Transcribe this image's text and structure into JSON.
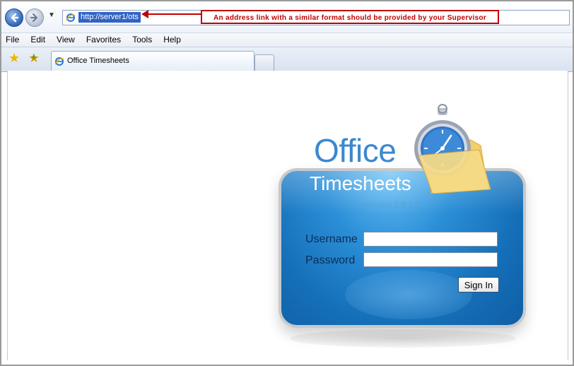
{
  "browser": {
    "address_url": "http://server1/ots",
    "annotation_text": "An address link with a similar format should be provided by your Supervisor",
    "menu": [
      "File",
      "Edit",
      "View",
      "Favorites",
      "Tools",
      "Help"
    ],
    "tab_title": "Office Timesheets",
    "icons": {
      "back": "back-arrow-icon",
      "forward": "forward-arrow-icon",
      "favorites": "star-icon",
      "add_favorite": "add-favorite-icon",
      "page": "ie-page-icon"
    }
  },
  "app": {
    "logo_word": "Office",
    "title": "Timesheets",
    "version": "Version 2.0.1.0",
    "username_label": "Username",
    "password_label": "Password",
    "username_value": "",
    "password_value": "",
    "signin_label": "Sign In",
    "logo_icon": "stopwatch-folder-icon"
  },
  "colors": {
    "annotation": "#c00000",
    "panel_blue": "#2b8fd8",
    "logo_blue": "#3b88cf",
    "url_highlight": "#3163c5"
  }
}
